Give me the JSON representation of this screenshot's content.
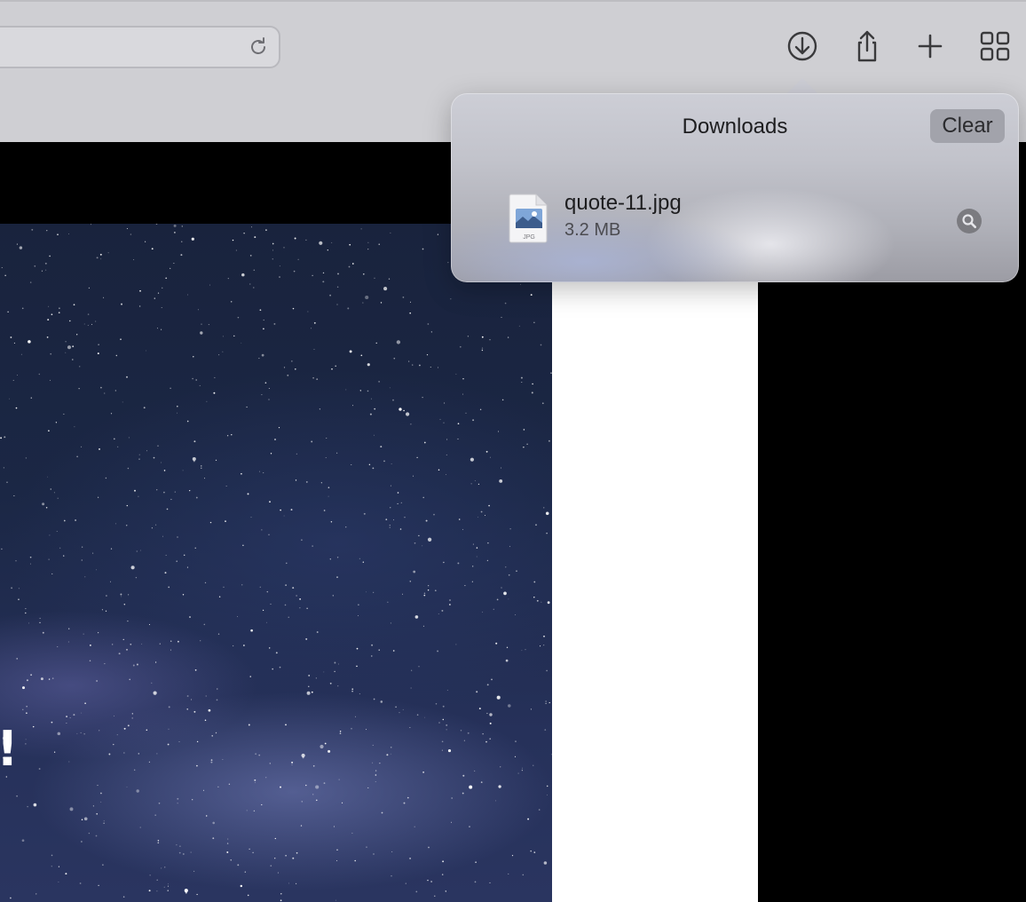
{
  "toolbar": {
    "icons": [
      "reload-icon",
      "download-icon",
      "share-icon",
      "plus-icon",
      "tab-overview-icon"
    ]
  },
  "content": {
    "visible_text": "!"
  },
  "downloads": {
    "title": "Downloads",
    "clear_label": "Clear",
    "items": [
      {
        "name": "quote-11.jpg",
        "size": "3.2 MB",
        "type_label": "JPG",
        "icon": "jpg-file-icon",
        "action_icon": "magnifier-icon"
      }
    ]
  },
  "colors": {
    "toolbar": "#cfcfd3",
    "popover": "#c6c7cf",
    "clear_button": "#a2a3ab"
  }
}
